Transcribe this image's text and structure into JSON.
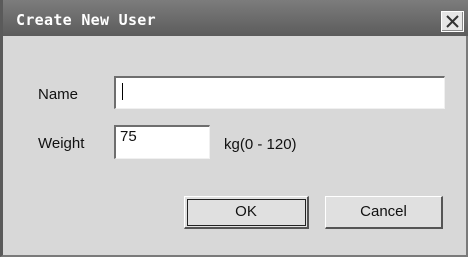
{
  "window": {
    "title": "Create New User",
    "close_icon": "close-icon"
  },
  "form": {
    "name_label": "Name",
    "name_value": "",
    "weight_label": "Weight",
    "weight_value": "75",
    "weight_unit": "kg(0 - 120)"
  },
  "buttons": {
    "ok_label": "OK",
    "cancel_label": "Cancel"
  },
  "colors": {
    "titlebar": "#6a6a6a",
    "dialog_bg": "#d8d8d8"
  }
}
